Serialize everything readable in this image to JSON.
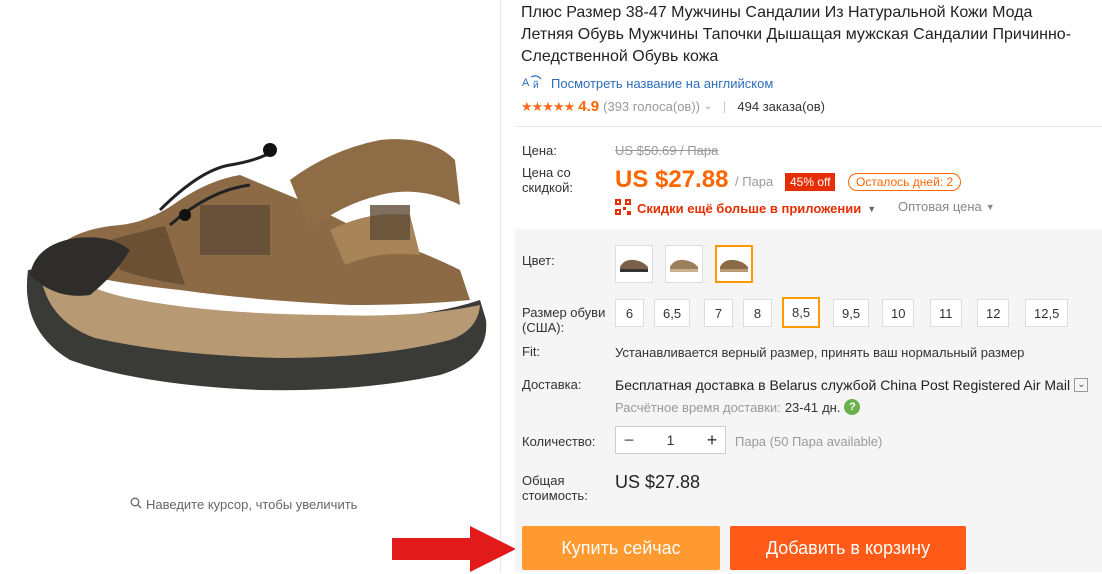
{
  "product": {
    "title_lines": [
      "Плюс Размер 38-47 Мужчины Сандалии Из Натуральной Кожи Мода",
      "Летняя Обувь Мужчины Тапочки Дышащая мужская Сандалии Причинно-",
      "Следственной Обувь кожа"
    ],
    "translate_link": "Посмотреть название на английском",
    "rating_score": "4.9",
    "rating_votes": "(393 голоса(ов))",
    "orders": "494 заказа(ов)"
  },
  "price": {
    "label": "Цена:",
    "old_price": "US $50.69 / Пара",
    "discount_label_line1": "Цена со",
    "discount_label_line2": "скидкой:",
    "current_price": "US $27.88",
    "unit": "/ Пара",
    "discount_badge": "45% off",
    "days_left": "Осталось дней: 2",
    "app_link": "Скидки ещё больше в приложении",
    "wholesale": "Оптовая цена"
  },
  "options": {
    "color_label": "Цвет:",
    "size_label_line1": "Размер обуви",
    "size_label_line2": "(США):",
    "sizes": [
      "6",
      "6,5",
      "7",
      "8",
      "8,5",
      "9,5",
      "10",
      "11",
      "12",
      "12,5"
    ],
    "selected_size": "8,5",
    "fit_label": "Fit:",
    "fit_text": "Устанавливается верный размер, принять ваш нормальный размер"
  },
  "shipping": {
    "label": "Доставка:",
    "method": "Бесплатная доставка в Belarus службой China Post Registered Air Mail",
    "eta_label": "Расчётное время доставки:",
    "eta_value": "23-41",
    "eta_unit": "дн."
  },
  "quantity": {
    "label": "Количество:",
    "value": "1",
    "hint": "Пара (50 Пара available)"
  },
  "total": {
    "label_line1": "Общая",
    "label_line2": "стоимость:",
    "value": "US $27.88"
  },
  "gallery": {
    "zoom_hint": "Наведите курсор, чтобы увеличить"
  },
  "buttons": {
    "buy_now": "Купить сейчас",
    "add_to_cart": "Добавить в корзину"
  },
  "colors": {
    "accent_orange": "#ff6600",
    "buy_button": "#ff9a30",
    "cart_button": "#ff5a17",
    "discount_red": "#e62e04",
    "link_blue": "#2c6dbc",
    "selected_border": "#ff9900"
  }
}
